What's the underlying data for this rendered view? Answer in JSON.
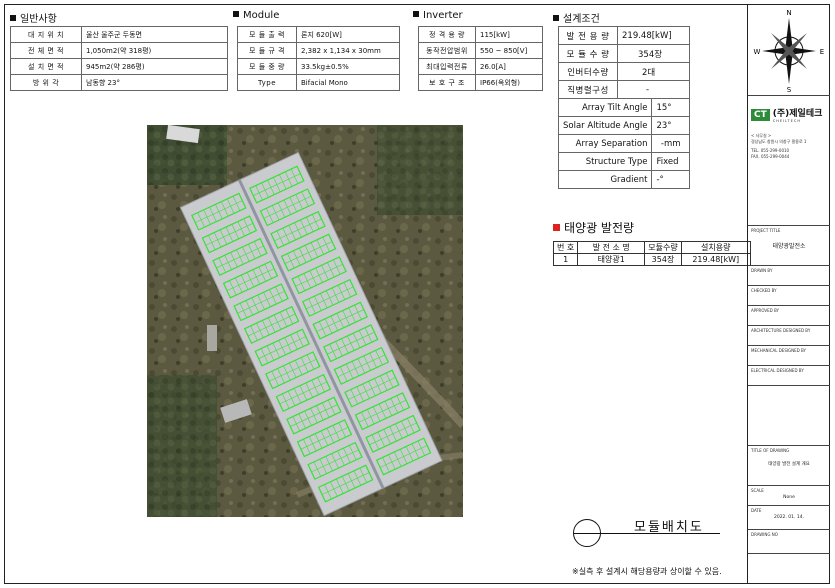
{
  "general": {
    "title": "일반사항",
    "rows": [
      {
        "k": "대 지 위 치",
        "v": "울산 울주군 두동면"
      },
      {
        "k": "전 체 면 적",
        "v": "1,050m2(약 318평)"
      },
      {
        "k": "설 치 면 적",
        "v": "945m2(약 286평)"
      },
      {
        "k": "방   위   각",
        "v": "남동향 23°"
      }
    ]
  },
  "module": {
    "title": "Module",
    "rows": [
      {
        "k": "모 듈 출 력",
        "v": "론지 620[W]"
      },
      {
        "k": "모 듈 규 격",
        "v": "2,382 x 1,134 x 30mm"
      },
      {
        "k": "모 듈 중 량",
        "v": "33.5kg±0.5%"
      },
      {
        "k": "Type",
        "v": "Bifacial Mono"
      }
    ]
  },
  "inverter": {
    "title": "Inverter",
    "rows": [
      {
        "k": "정 격 용 량",
        "v": "115[kW]"
      },
      {
        "k": "동작전압범위",
        "v": "550 ~ 850[V]"
      },
      {
        "k": "최대입력전류",
        "v": "26.0[A]"
      },
      {
        "k": "보 호 구 조",
        "v": "IP66(옥외형)"
      }
    ]
  },
  "design": {
    "title": "설계조건",
    "rows": [
      {
        "k": "발 전 용 량",
        "v": "219.48[kW]"
      },
      {
        "k": "모 듈 수 량",
        "v": "354장"
      },
      {
        "k": "인버터수량",
        "v": "2대"
      },
      {
        "k": "직병렬구성",
        "v": "-"
      }
    ],
    "rows2": [
      {
        "k": "Array Tilt Angle",
        "v": "15°"
      },
      {
        "k": "Solar Altitude Angle",
        "v": "23°"
      },
      {
        "k": "Array Separation",
        "v": "-mm"
      },
      {
        "k": "Structure Type",
        "v": "Fixed"
      },
      {
        "k": "Gradient",
        "v": "-°"
      }
    ]
  },
  "generation": {
    "title": "태양광 발전량",
    "headers": [
      "번 호",
      "발 전 소 명",
      "모듈수량",
      "설치용량"
    ],
    "rows": [
      [
        "1",
        "태양광1",
        "354장",
        "219.48[kW]"
      ]
    ]
  },
  "drawing": {
    "title": "모듈배치도",
    "note": "※실측 후 설계시 해당용량과 상이할 수 있음."
  },
  "title_block": {
    "compass_n": "N",
    "compass_s": "S",
    "compass_e": "E",
    "compass_w": "W",
    "company_logo_text": "CT",
    "company_name": "(주)제일테크",
    "company_sub": "CHEILTECH",
    "office_label": "< 사무실 >",
    "address": "경상남도 창원시 의창구 팔용로 1",
    "tel": "TEL. 055-299-0010",
    "fax": "FAX. 055-299-0044",
    "project_label": "PROJECT TITLE",
    "project_value": "태양광발전소",
    "drawn_label": "DRAWN BY",
    "checked_label": "CHECKED BY",
    "approved_label": "APPROVED BY",
    "arch_label": "ARCHITECTURE DESIGNED BY",
    "mech_label": "MECHANICAL DESIGNED BY",
    "elec_label": "ELECTRICAL DESIGNED BY",
    "dwg_label": "TITLE OF DRAWING",
    "dwg_value": "태양광 발전 설계 개요",
    "scale_label": "SCALE",
    "scale_value": "None",
    "date_label": "DATE",
    "date_value": "2022. 01. 14.",
    "dwgno_label": "DRAWING NO"
  },
  "colors": {
    "module_green": "#36e236",
    "roof": "#c9cbcf",
    "ground": "#5b5a40"
  }
}
